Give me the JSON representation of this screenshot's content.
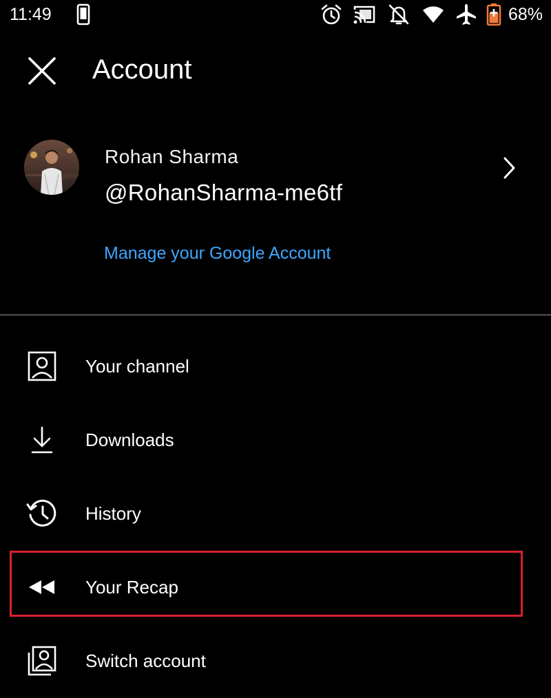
{
  "status_bar": {
    "time": "11:49",
    "battery_percent": "68%",
    "icons": [
      "phone-vibrate-icon",
      "alarm-icon",
      "cast-icon",
      "notifications-off-icon",
      "wifi-icon",
      "airplane-mode-icon",
      "battery-charging-icon"
    ]
  },
  "header": {
    "title": "Account",
    "close_icon": "close-icon"
  },
  "profile": {
    "name": "Rohan Sharma",
    "handle": "@RohanSharma-me6tf",
    "manage_link": "Manage your Google Account"
  },
  "menu": {
    "items": [
      {
        "label": "Your channel",
        "icon": "account-box-icon"
      },
      {
        "label": "Downloads",
        "icon": "download-icon"
      },
      {
        "label": "History",
        "icon": "history-icon"
      },
      {
        "label": "Your Recap",
        "icon": "rewind-icon"
      },
      {
        "label": "Switch account",
        "icon": "switch-account-icon"
      }
    ]
  },
  "colors": {
    "background": "#000000",
    "text": "#ffffff",
    "link": "#3ea6ff",
    "divider": "#3d3d3d",
    "highlight": "#d7212f",
    "battery_accent": "#f07a3a"
  }
}
